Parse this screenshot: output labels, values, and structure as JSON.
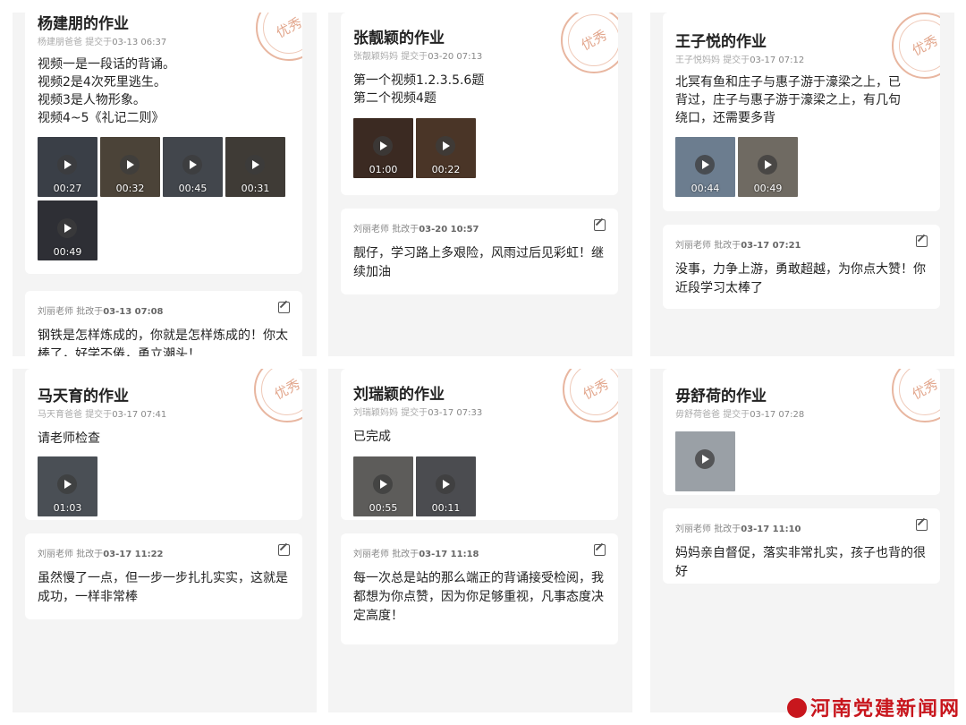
{
  "cards": [
    {
      "title": "杨建朋的作业",
      "submitter": "杨建朋爸爸",
      "submit_label": "提交于",
      "submit_time": "03-13 06:37",
      "stamp": "优秀",
      "content_lines": [
        "视频一是一段话的背诵。",
        "视频2是4次死里逃生。",
        "视频3是人物形象。",
        "视频4~5《礼记二则》"
      ],
      "videos": [
        "00:27",
        "00:32",
        "00:45",
        "00:31",
        "00:49"
      ],
      "feedback": {
        "teacher": "刘丽老师",
        "label": "批改于",
        "time": "03-13 07:08",
        "text": "钢铁是怎样炼成的，你就是怎样炼成的！你太棒了，好学不倦，勇立潮头！"
      }
    },
    {
      "title": "张靓颖的作业",
      "submitter": "张靓颖妈妈",
      "submit_label": "提交于",
      "submit_time": "03-20 07:13",
      "stamp": "优秀",
      "content_lines": [
        "第一个视频1.2.3.5.6题",
        "第二个视频4题"
      ],
      "videos": [
        "01:00",
        "00:22"
      ],
      "feedback": {
        "teacher": "刘丽老师",
        "label": "批改于",
        "time": "03-20 10:57",
        "text": "靓仔，学习路上多艰险，风雨过后见彩虹！继续加油"
      }
    },
    {
      "title": "王子悦的作业",
      "submitter": "王子悦妈妈",
      "submit_label": "提交于",
      "submit_time": "03-17 07:12",
      "stamp": "优秀",
      "content_lines": [
        "北冥有鱼和庄子与惠子游于濠梁之上，已",
        "背过，庄子与惠子游于濠梁之上，有几句",
        "绕口，还需要多背"
      ],
      "videos": [
        "00:44",
        "00:49"
      ],
      "feedback": {
        "teacher": "刘丽老师",
        "label": "批改于",
        "time": "03-17 07:21",
        "text": "没事，力争上游，勇敢超越，为你点大赞！你近段学习太棒了"
      }
    },
    {
      "title": "马天育的作业",
      "submitter": "马天育爸爸",
      "submit_label": "提交于",
      "submit_time": "03-17 07:41",
      "stamp": "优秀",
      "content_lines": [
        "请老师检查"
      ],
      "videos": [
        "01:03"
      ],
      "feedback": {
        "teacher": "刘丽老师",
        "label": "批改于",
        "time": "03-17 11:22",
        "text": "虽然慢了一点，但一步一步扎扎实实，这就是成功，一样非常棒"
      }
    },
    {
      "title": "刘瑞颖的作业",
      "submitter": "刘瑞颖妈妈",
      "submit_label": "提交于",
      "submit_time": "03-17 07:33",
      "stamp": "优秀",
      "content_lines": [
        "已完成"
      ],
      "videos": [
        "00:55",
        "00:11"
      ],
      "feedback": {
        "teacher": "刘丽老师",
        "label": "批改于",
        "time": "03-17 11:18",
        "text": "每一次总是站的那么端正的背诵接受检阅，我都想为你点赞，因为你足够重视，凡事态度决定高度！"
      }
    },
    {
      "title": "毋舒荷的作业",
      "submitter": "毋舒荷爸爸",
      "submit_label": "提交于",
      "submit_time": "03-17 07:28",
      "stamp": "优秀",
      "content_lines": [],
      "videos": [
        ""
      ],
      "feedback": {
        "teacher": "刘丽老师",
        "label": "批改于",
        "time": "03-17 11:10",
        "text": "妈妈亲自督促，落实非常扎实，孩子也背的很好"
      }
    }
  ],
  "watermark": "河南党建新闻网",
  "colors": {
    "stamp": "#e2a68c",
    "watermark": "#c8161d",
    "panel_bg": "#f4f4f4"
  }
}
